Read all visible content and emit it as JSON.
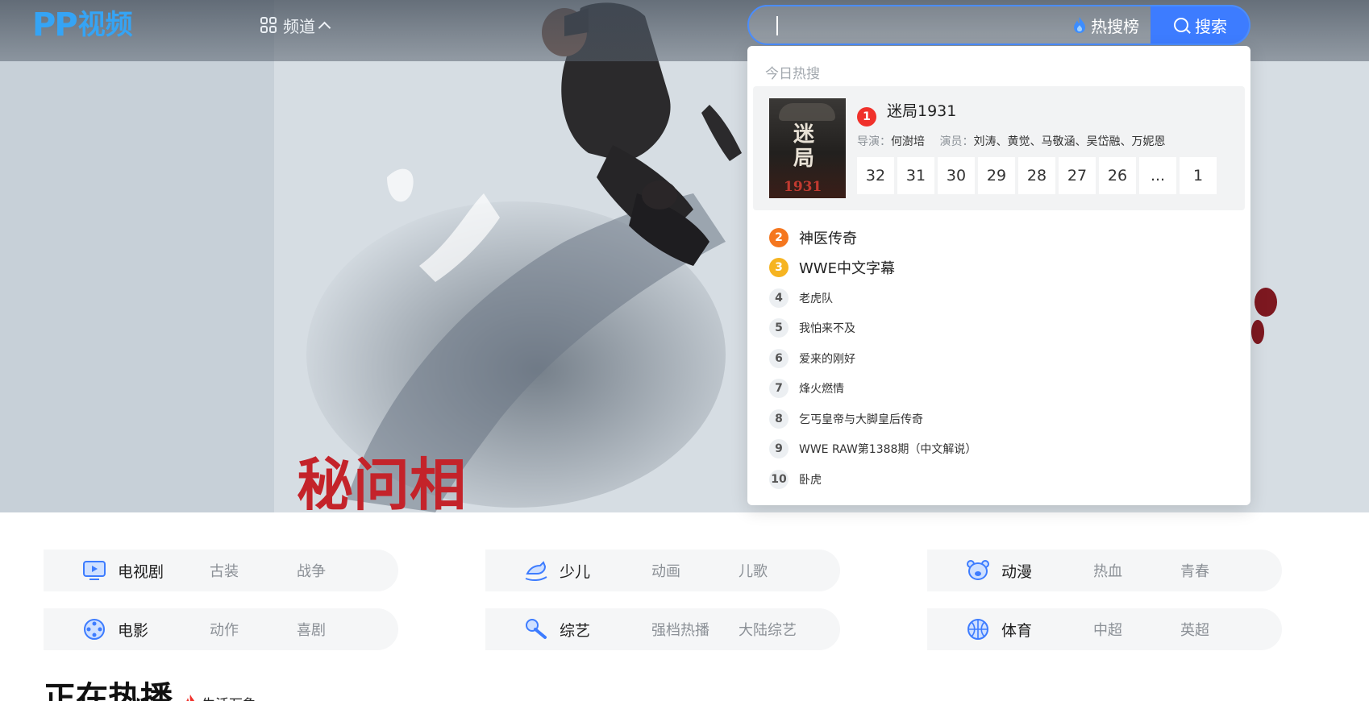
{
  "header": {
    "logo_mark": "PP",
    "logo_text": "视频",
    "channel_label": "频道"
  },
  "search": {
    "value": "",
    "placeholder": "",
    "hot_label": "热搜榜",
    "button_label": "搜索"
  },
  "hot_dropdown": {
    "title": "今日热搜",
    "featured": {
      "rank": "1",
      "title": "迷局1931",
      "poster_title": "迷局",
      "poster_year": "1931",
      "director_label": "导演：",
      "director": "何澍培",
      "cast_label": "演员：",
      "cast": "刘涛、黄觉、马敬涵、吴岱融、万妮恩",
      "episodes": [
        "32",
        "31",
        "30",
        "29",
        "28",
        "27",
        "26",
        "...",
        "1"
      ]
    },
    "items": [
      {
        "rank": "2",
        "name": "神医传奇"
      },
      {
        "rank": "3",
        "name": "WWE中文字幕"
      },
      {
        "rank": "4",
        "name": "老虎队"
      },
      {
        "rank": "5",
        "name": "我怕来不及"
      },
      {
        "rank": "6",
        "name": "爱来的刚好"
      },
      {
        "rank": "7",
        "name": "烽火燃情"
      },
      {
        "rank": "8",
        "name": "乞丐皇帝与大脚皇后传奇"
      },
      {
        "rank": "9",
        "name": "WWE RAW第1388期（中文解说）"
      },
      {
        "rank": "10",
        "name": "卧虎"
      }
    ]
  },
  "hero": {
    "title_art": "秘问相"
  },
  "categories": [
    {
      "name": "电视剧",
      "icon": "tv-icon",
      "subs": [
        "古装",
        "战争"
      ]
    },
    {
      "name": "少儿",
      "icon": "rocking-horse-icon",
      "subs": [
        "动画",
        "儿歌"
      ]
    },
    {
      "name": "动漫",
      "icon": "bear-face-icon",
      "subs": [
        "热血",
        "青春"
      ]
    },
    {
      "name": "电影",
      "icon": "film-reel-icon",
      "subs": [
        "动作",
        "喜剧"
      ]
    },
    {
      "name": "综艺",
      "icon": "microphone-icon",
      "subs": [
        "强档热播",
        "大陆综艺"
      ]
    },
    {
      "name": "体育",
      "icon": "basketball-icon",
      "subs": [
        "中超",
        "英超"
      ]
    }
  ],
  "section": {
    "title": "正在热播",
    "tag": "生活万象"
  },
  "colors": {
    "accent": "#3d7cff",
    "brand_blue": "#35a4f5",
    "brand_yellow": "#f9c31b",
    "rank1": "#f0312b",
    "rank2": "#f5771f",
    "rank3": "#f6b421"
  }
}
